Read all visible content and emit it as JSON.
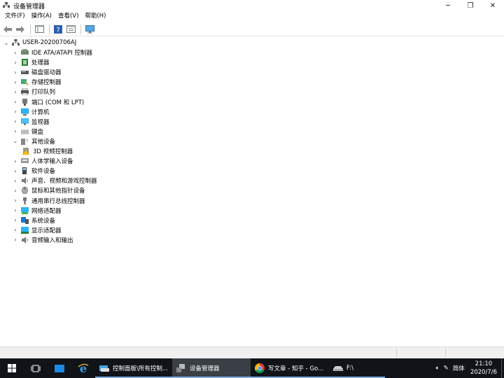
{
  "window": {
    "title": "设备管理器",
    "minimize": "─",
    "restore": "❐",
    "close": "✕"
  },
  "menu": [
    "文件(F)",
    "操作(A)",
    "查看(V)",
    "帮助(H)"
  ],
  "tree": {
    "root": "USER-20200706AJ",
    "items": [
      {
        "label": "IDE ATA/ATAPI 控制器",
        "icon": "ide-controller-icon",
        "expanded": false
      },
      {
        "label": "处理器",
        "icon": "processor-icon",
        "expanded": false
      },
      {
        "label": "磁盘驱动器",
        "icon": "disk-drive-icon",
        "expanded": false
      },
      {
        "label": "存储控制器",
        "icon": "storage-controller-icon",
        "expanded": false
      },
      {
        "label": "打印队列",
        "icon": "printer-icon",
        "expanded": false
      },
      {
        "label": "端口 (COM 和 LPT)",
        "icon": "port-icon",
        "expanded": false
      },
      {
        "label": "计算机",
        "icon": "computer-icon",
        "expanded": false
      },
      {
        "label": "监视器",
        "icon": "monitor-icon",
        "expanded": false
      },
      {
        "label": "键盘",
        "icon": "keyboard-icon",
        "expanded": false
      },
      {
        "label": "其他设备",
        "icon": "other-devices-icon",
        "expanded": true
      },
      {
        "label": "3D 视频控制器",
        "icon": "warning-device-icon",
        "child": true
      },
      {
        "label": "人体学输入设备",
        "icon": "hid-icon",
        "expanded": false
      },
      {
        "label": "软件设备",
        "icon": "software-device-icon",
        "expanded": false
      },
      {
        "label": "声音、视频和游戏控制器",
        "icon": "sound-icon",
        "expanded": false
      },
      {
        "label": "鼠标和其他指针设备",
        "icon": "mouse-icon",
        "expanded": false
      },
      {
        "label": "通用串行总线控制器",
        "icon": "usb-icon",
        "expanded": false
      },
      {
        "label": "网络适配器",
        "icon": "network-adapter-icon",
        "expanded": false
      },
      {
        "label": "系统设备",
        "icon": "system-device-icon",
        "expanded": false
      },
      {
        "label": "显示适配器",
        "icon": "display-adapter-icon",
        "expanded": false
      },
      {
        "label": "音频输入和输出",
        "icon": "audio-io-icon",
        "expanded": false
      }
    ]
  },
  "taskbar": {
    "apps": [
      {
        "label": "控制面板\\所有控制...",
        "icon": "control-panel-icon"
      },
      {
        "label": "设备管理器",
        "icon": "device-manager-icon"
      },
      {
        "label": "写文章 - 知乎 - Go...",
        "icon": "chrome-icon"
      },
      {
        "label": "F:\\",
        "icon": "drive-icon"
      }
    ],
    "ime": "简体",
    "time": "21:10",
    "date": "2020/7/6",
    "colors": {
      "taskbar_bg": "#101418",
      "accent": "#7fb0e8"
    }
  }
}
